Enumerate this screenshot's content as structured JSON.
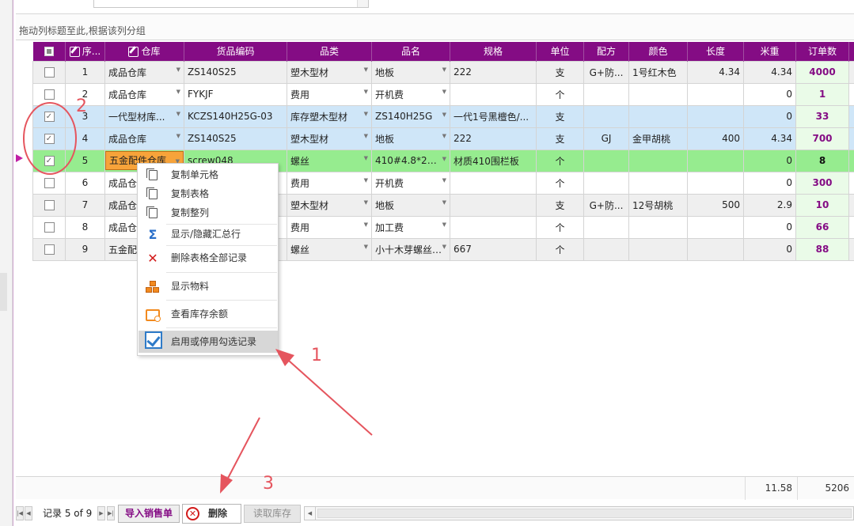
{
  "group_panel_hint": "拖动列标题至此,根据该列分组",
  "columns": [
    "序...",
    "仓库",
    "货品编码",
    "品类",
    "品名",
    "规格",
    "单位",
    "配方",
    "颜色",
    "长度",
    "米重",
    "订单数"
  ],
  "rows": [
    {
      "seq": "1",
      "warehouse": "成品仓库",
      "code": "ZS140S25",
      "category": "塑木型材",
      "name": "地板",
      "spec": "222",
      "unit": "支",
      "formula": "G+防...",
      "color": "1号红木色",
      "length": "4.34",
      "weight": "4.34",
      "orders": "4000",
      "checked": false
    },
    {
      "seq": "2",
      "warehouse": "成品仓库",
      "code": "FYKJF",
      "category": "费用",
      "name": "开机费",
      "spec": "",
      "unit": "个",
      "formula": "",
      "color": "",
      "length": "",
      "weight": "0",
      "orders": "1",
      "checked": false
    },
    {
      "seq": "3",
      "warehouse": "一代型材库...",
      "code": "KCZS140H25G-03",
      "category": "库存塑木型材",
      "name": "ZS140H25G",
      "spec": "一代1号黑檀色/...",
      "unit": "支",
      "formula": "",
      "color": "",
      "length": "",
      "weight": "0",
      "orders": "33",
      "checked": true
    },
    {
      "seq": "4",
      "warehouse": "成品仓库",
      "code": "ZS140S25",
      "category": "塑木型材",
      "name": "地板",
      "spec": "222",
      "unit": "支",
      "formula": "GJ",
      "color": "金甲胡桃",
      "length": "400",
      "weight": "4.34",
      "orders": "700",
      "checked": true
    },
    {
      "seq": "5",
      "warehouse": "五金配件仓库",
      "code": "screw048",
      "category": "螺丝",
      "name": "410#4.8*25...",
      "spec": "材质410围栏板",
      "unit": "个",
      "formula": "",
      "color": "",
      "length": "",
      "weight": "0",
      "orders": "8",
      "checked": true
    },
    {
      "seq": "6",
      "warehouse": "成品仓",
      "code": "",
      "category": "费用",
      "name": "开机费",
      "spec": "",
      "unit": "个",
      "formula": "",
      "color": "",
      "length": "",
      "weight": "0",
      "orders": "300",
      "checked": false
    },
    {
      "seq": "7",
      "warehouse": "成品仓",
      "code": "",
      "category": "塑木型材",
      "name": "地板",
      "spec": "",
      "unit": "支",
      "formula": "G+防...",
      "color": "12号胡桃",
      "length": "500",
      "weight": "2.9",
      "orders": "10",
      "checked": false
    },
    {
      "seq": "8",
      "warehouse": "成品仓",
      "code": "",
      "category": "费用",
      "name": "加工费",
      "spec": "",
      "unit": "个",
      "formula": "",
      "color": "",
      "length": "",
      "weight": "0",
      "orders": "66",
      "checked": false
    },
    {
      "seq": "9",
      "warehouse": "五金配",
      "code": "",
      "category": "螺丝",
      "name": "小十木芽螺丝4...",
      "spec": "667",
      "unit": "个",
      "formula": "",
      "color": "",
      "length": "",
      "weight": "0",
      "orders": "88",
      "checked": false
    }
  ],
  "footer_totals": {
    "weight": "11.58",
    "orders": "5206"
  },
  "nav": {
    "record_text": "记录 5 of 9",
    "import_button": "导入销售单",
    "delete_button": "删除",
    "read_stock_button": "读取库存"
  },
  "context_menu": {
    "items": [
      {
        "label": "复制单元格",
        "icon": "copy-icon"
      },
      {
        "label": "复制表格",
        "icon": "copy-icon"
      },
      {
        "label": "复制整列",
        "icon": "copy-icon"
      },
      {
        "label": "显示/隐藏汇总行",
        "icon": "sigma-icon"
      },
      {
        "label": "删除表格全部记录",
        "icon": "delete-x-icon"
      },
      {
        "label": "显示物料",
        "icon": "materials-icon"
      },
      {
        "label": "查看库存余额",
        "icon": "inventory-icon"
      },
      {
        "label": "启用或停用勾选记录",
        "icon": "check-icon"
      }
    ]
  },
  "annotations": {
    "n1": "1",
    "n2": "2",
    "n3": "3"
  },
  "colors": {
    "header": "#840c84",
    "selected_row": "#96ec8f",
    "checked_row": "#cfe6f8",
    "annotation": "#e5555e"
  }
}
